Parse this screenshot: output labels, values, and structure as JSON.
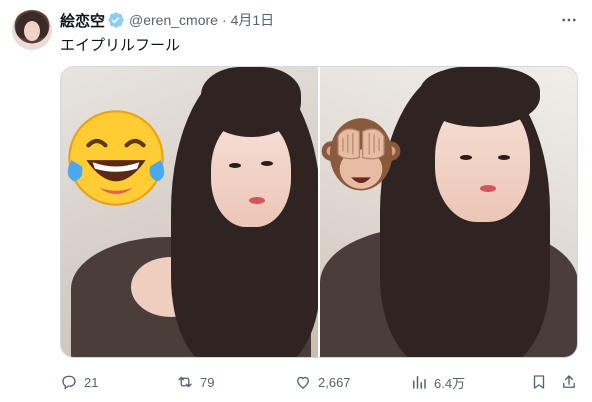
{
  "tweet": {
    "author_name": "絵恋空",
    "handle": "@eren_cmore",
    "separator": "·",
    "date": "4月1日",
    "text": "エイプリルフール",
    "verified_color": "#8ecdf8"
  },
  "media": {
    "photos": [
      {
        "overlay": "laughing-tears-emoji"
      },
      {
        "overlay": "see-no-evil-monkey-emoji"
      }
    ]
  },
  "actions": {
    "replies": "21",
    "retweets": "79",
    "likes": "2,667",
    "views": "6.4万"
  },
  "colors": {
    "text": "#0f1419",
    "secondary": "#536471",
    "border": "#cfd9de"
  }
}
